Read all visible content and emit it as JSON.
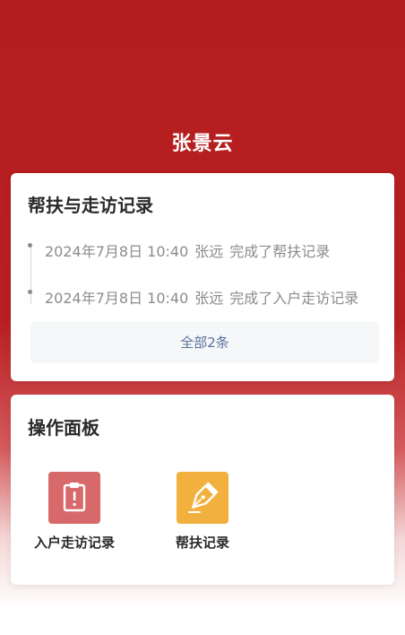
{
  "header": {
    "user_name": "张景云"
  },
  "records": {
    "title": "帮扶与走访记录",
    "items": [
      {
        "time": "2024年7月8日 10:40",
        "person": "张远",
        "action": "完成了帮扶记录"
      },
      {
        "time": "2024年7月8日 10:40",
        "person": "张远",
        "action": "完成了入户走访记录"
      }
    ],
    "view_all_label": "全部2条"
  },
  "panel": {
    "title": "操作面板",
    "actions": [
      {
        "label": "入户走访记录",
        "icon": "clipboard-alert-icon",
        "color": "#d8696a"
      },
      {
        "label": "帮扶记录",
        "icon": "pen-nib-icon",
        "color": "#f2b03e"
      }
    ]
  },
  "colors": {
    "brand": "#b81f22",
    "link": "#57739a"
  }
}
